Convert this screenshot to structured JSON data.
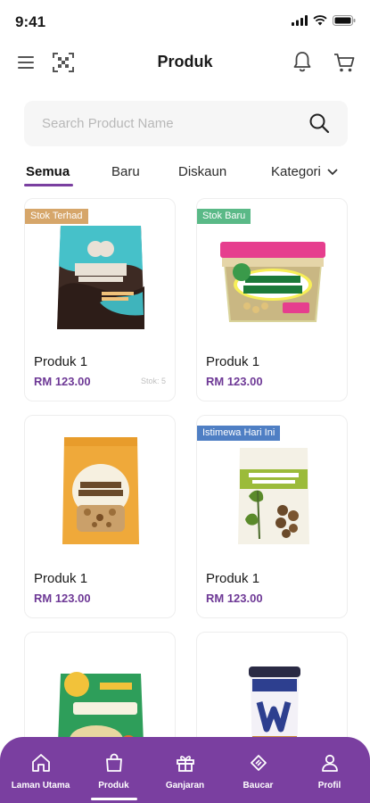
{
  "status_bar": {
    "time": "9:41"
  },
  "header": {
    "title": "Produk",
    "icons": [
      "menu-icon",
      "qr-scan-icon",
      "bell-icon",
      "cart-icon"
    ]
  },
  "search": {
    "placeholder": "Search Product Name",
    "value": ""
  },
  "tabs": [
    {
      "label": "Semua",
      "active": true
    },
    {
      "label": "Baru",
      "active": false
    },
    {
      "label": "Diskaun",
      "active": false
    },
    {
      "label": "Kategori",
      "active": false
    }
  ],
  "products": [
    {
      "name": "Produk 1",
      "price": "RM 123.00",
      "badge": "Stok Terhad",
      "badge_color": "#d6a66a",
      "stock": "Stok: 5"
    },
    {
      "name": "Produk 1",
      "price": "RM 123.00",
      "badge": "Stok Baru",
      "badge_color": "#5ab987",
      "stock": ""
    },
    {
      "name": "Produk 1",
      "price": "RM 123.00",
      "badge": "",
      "badge_color": "",
      "stock": ""
    },
    {
      "name": "Produk 1",
      "price": "RM 123.00",
      "badge": "Istimewa Hari Ini",
      "badge_color": "#4f7fc4",
      "stock": ""
    },
    {
      "name": "",
      "price": "",
      "badge": "",
      "badge_color": "",
      "stock": ""
    },
    {
      "name": "",
      "price": "",
      "badge": "",
      "badge_color": "",
      "stock": ""
    }
  ],
  "bottom_nav": [
    {
      "label": "Laman Utama",
      "icon": "home-icon",
      "active": false
    },
    {
      "label": "Produk",
      "icon": "shopping-bag-icon",
      "active": true
    },
    {
      "label": "Ganjaran",
      "icon": "gift-icon",
      "active": false
    },
    {
      "label": "Baucar",
      "icon": "voucher-icon",
      "active": false
    },
    {
      "label": "Profil",
      "icon": "profile-icon",
      "active": false
    }
  ],
  "colors": {
    "accent": "#7a3fa0",
    "price": "#6e3996"
  }
}
